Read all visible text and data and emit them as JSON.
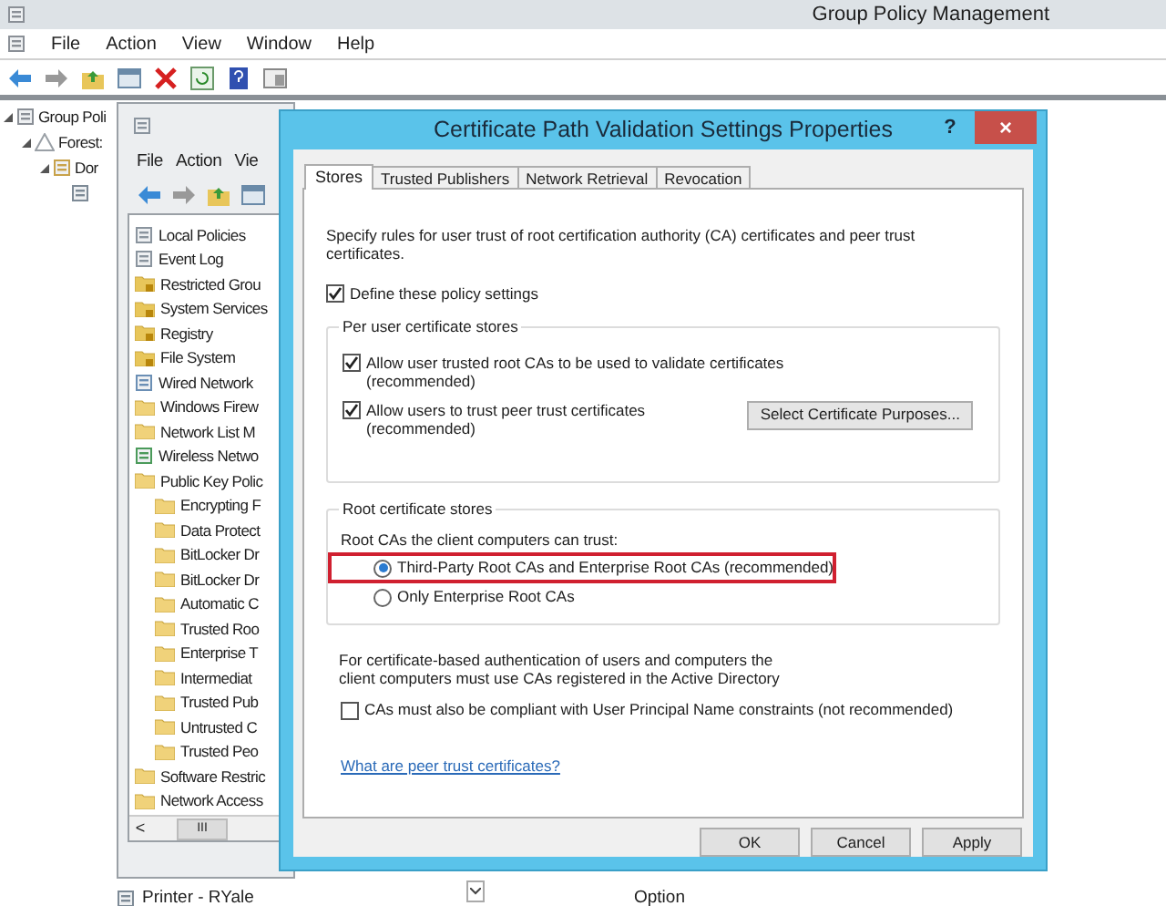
{
  "main_window": {
    "title": "Group Policy Management",
    "menu": [
      "File",
      "Action",
      "View",
      "Window",
      "Help"
    ],
    "tree": [
      {
        "label": "Group Poli",
        "kind": "console",
        "children": [
          {
            "label": "Forest:",
            "kind": "forest",
            "children": [
              {
                "label": "Dor",
                "kind": "domain",
                "children": [
                  {
                    "kind": "gpo"
                  }
                ]
              }
            ]
          }
        ]
      }
    ],
    "footer": [
      {
        "label": "Printer - RYale",
        "kind": "printer"
      },
      {
        "label": "Option",
        "kind": "column"
      }
    ]
  },
  "editor_window": {
    "menu": [
      "File",
      "Action",
      "Vie"
    ],
    "tree": [
      {
        "label": "Local Policies",
        "kind": "policy"
      },
      {
        "label": "Event Log",
        "kind": "policy"
      },
      {
        "label": "Restricted Grou",
        "kind": "locked"
      },
      {
        "label": "System Services",
        "kind": "locked"
      },
      {
        "label": "Registry",
        "kind": "locked"
      },
      {
        "label": "File System",
        "kind": "locked"
      },
      {
        "label": "Wired Network",
        "kind": "network"
      },
      {
        "label": "Windows Firew",
        "kind": "folder"
      },
      {
        "label": "Network List M",
        "kind": "folder"
      },
      {
        "label": "Wireless Netwo",
        "kind": "wireless"
      },
      {
        "label": "Public Key Polic",
        "kind": "folder",
        "children": [
          {
            "label": "Encrypting F",
            "kind": "folder"
          },
          {
            "label": "Data Protect",
            "kind": "folder"
          },
          {
            "label": "BitLocker Dr",
            "kind": "folder"
          },
          {
            "label": "BitLocker Dr",
            "kind": "folder"
          },
          {
            "label": "Automatic C",
            "kind": "folder"
          },
          {
            "label": "Trusted Roo",
            "kind": "folder"
          },
          {
            "label": "Enterprise T",
            "kind": "folder"
          },
          {
            "label": "Intermediat",
            "kind": "folder"
          },
          {
            "label": "Trusted Pub",
            "kind": "folder"
          },
          {
            "label": "Untrusted C",
            "kind": "folder"
          },
          {
            "label": "Trusted Peo",
            "kind": "folder"
          }
        ]
      },
      {
        "label": "Software Restric",
        "kind": "folder"
      },
      {
        "label": "Network Access",
        "kind": "folder"
      }
    ],
    "scroll_left": "<",
    "scroll_thumb": "III"
  },
  "dialog": {
    "title": "Certificate Path Validation Settings Properties",
    "help": "?",
    "close": "×",
    "tabs": [
      {
        "label": "Stores",
        "selected": true
      },
      {
        "label": "Trusted Publishers",
        "selected": false
      },
      {
        "label": "Network Retrieval",
        "selected": false
      },
      {
        "label": "Revocation",
        "selected": false
      }
    ],
    "description": "Specify rules for user trust of root certification authority (CA) certificates and peer trust certificates.",
    "define": {
      "label": "Define these policy settings",
      "checked": true
    },
    "per_user": {
      "title": "Per user certificate stores",
      "options": [
        {
          "label": "Allow user trusted root CAs to be used to validate certificates",
          "note": "(recommended)",
          "checked": true
        },
        {
          "label": "Allow users to trust peer trust certificates",
          "note": "(recommended)",
          "checked": true
        }
      ],
      "button": "Select Certificate Purposes..."
    },
    "root_stores": {
      "title": "Root certificate stores",
      "prompt": "Root CAs the client computers can trust:",
      "options": [
        {
          "label": "Third-Party Root CAs and Enterprise Root CAs (recommended)",
          "selected": true
        },
        {
          "label": "Only Enterprise Root CAs",
          "selected": false
        }
      ]
    },
    "auth_text": "For certificate-based authentication of users and computers the client computers must use CAs registered in the Active Directory",
    "upn": {
      "label": "CAs must also be compliant with User Principal Name constraints (not recommended)",
      "checked": false
    },
    "link": "What are peer trust certificates?",
    "buttons": [
      "OK",
      "Cancel",
      "Apply"
    ]
  }
}
